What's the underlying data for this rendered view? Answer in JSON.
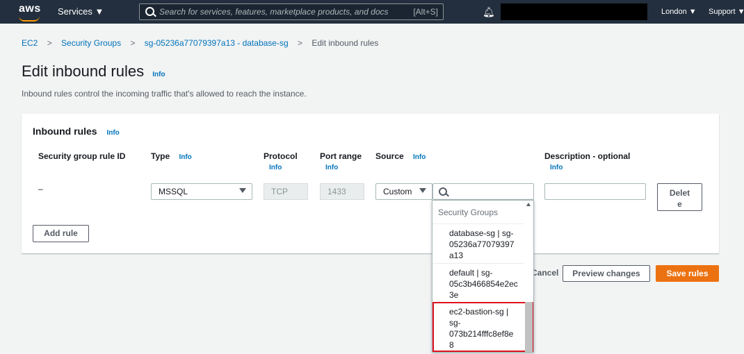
{
  "topbar": {
    "logo": "aws",
    "services": "Services ▼",
    "search_placeholder": "Search for services, features, marketplace products, and docs",
    "search_hotkey": "[Alt+S]",
    "bell_icon": "bell-icon",
    "region": "London ▼",
    "support": "Support ▼"
  },
  "breadcrumb": {
    "items": [
      "EC2",
      "Security Groups",
      "sg-05236a77079397a13 - database-sg"
    ],
    "current": "Edit inbound rules",
    "separator": ">"
  },
  "page": {
    "title": "Edit inbound rules",
    "info": "Info",
    "description": "Inbound rules control the incoming traffic that's allowed to reach the instance."
  },
  "panel": {
    "title": "Inbound rules",
    "info": "Info",
    "columns": {
      "rule_id": "Security group rule ID",
      "type": "Type",
      "protocol": "Protocol",
      "port_range": "Port range",
      "source": "Source",
      "description": "Description - optional"
    },
    "row": {
      "rule_id": "–",
      "type": "MSSQL",
      "protocol": "TCP",
      "port_range": "1433",
      "source_type": "Custom",
      "source_value": "",
      "description": "",
      "delete_label": "Delete"
    },
    "add_rule": "Add rule"
  },
  "footer": {
    "cancel": "Cancel",
    "preview": "Preview changes",
    "save": "Save rules"
  },
  "dropdown": {
    "header": "Security Groups",
    "items": [
      {
        "line1": "database-sg | sg-",
        "line2": "05236a77079397",
        "line3": "a13"
      },
      {
        "line1": "default | sg-",
        "line2": "05c3b466854e2ec",
        "line3": "3e"
      },
      {
        "line1": "ec2-bastion-sg |",
        "line2": "sg-",
        "line3": "073b214fffc8ef8e",
        "line4": "8"
      }
    ],
    "highlight_color": "#e0101e"
  },
  "colors": {
    "topbar": "#232f3e",
    "link": "#0073bb",
    "primary": "#ec7211"
  }
}
